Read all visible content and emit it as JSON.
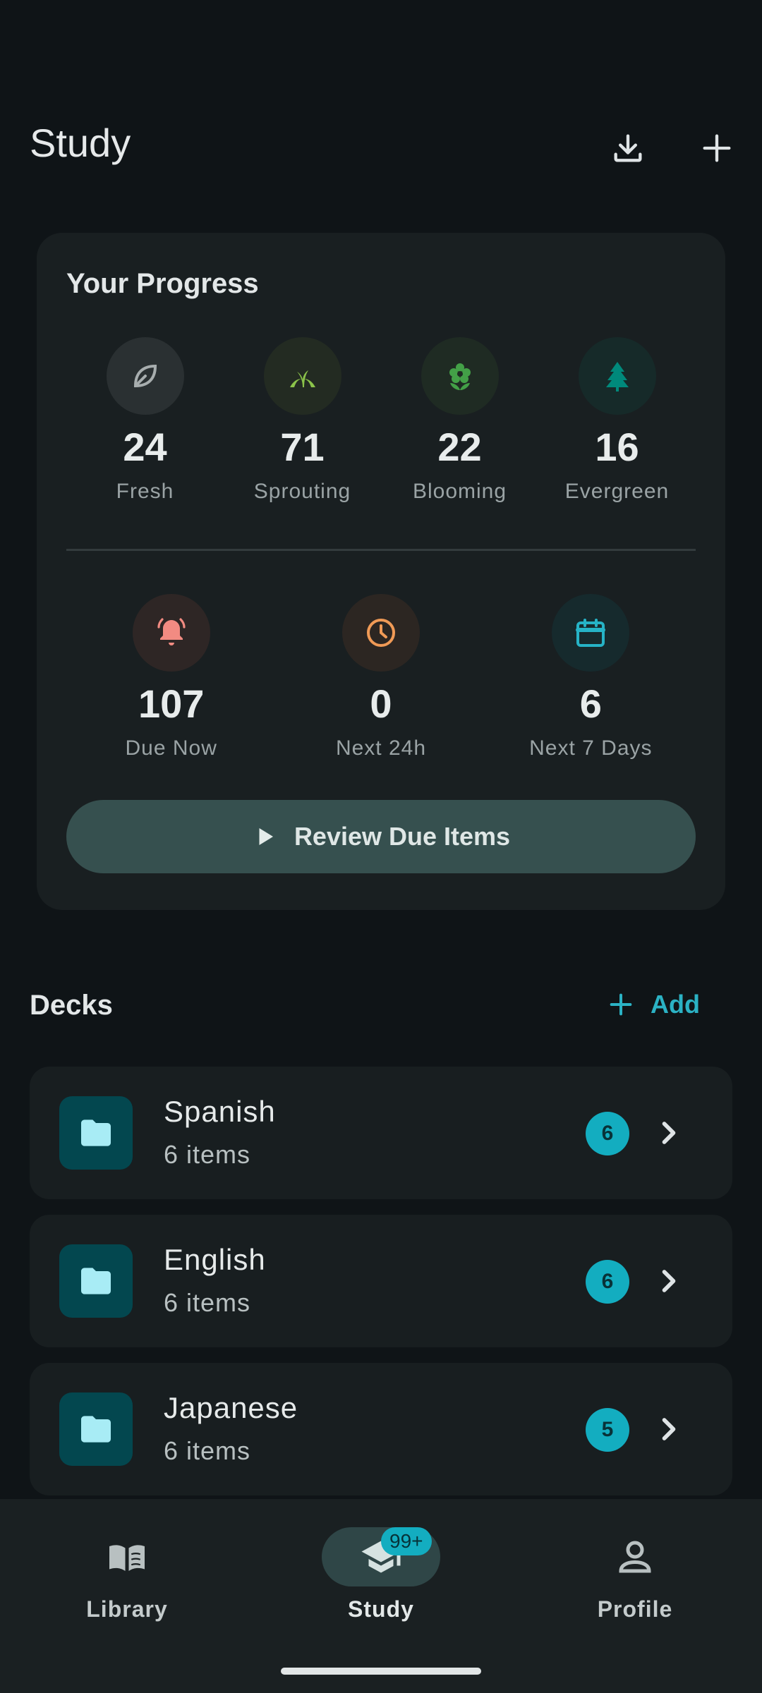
{
  "app_bar": {
    "title": "Study"
  },
  "progress": {
    "title": "Your Progress",
    "stages": [
      {
        "value": "24",
        "label": "Fresh",
        "icon": "leaf-icon",
        "color": "#a7adae"
      },
      {
        "value": "71",
        "label": "Sprouting",
        "icon": "sprout-icon",
        "color": "#8bc34a"
      },
      {
        "value": "22",
        "label": "Blooming",
        "icon": "flower-icon",
        "color": "#43a047"
      },
      {
        "value": "16",
        "label": "Evergreen",
        "icon": "tree-icon",
        "color": "#00897b"
      }
    ],
    "due": [
      {
        "value": "107",
        "label": "Due Now",
        "icon": "bell-icon",
        "color": "#f28b82"
      },
      {
        "value": "0",
        "label": "Next 24h",
        "icon": "clock-icon",
        "color": "#f09a56"
      },
      {
        "value": "6",
        "label": "Next 7 Days",
        "icon": "calendar-icon",
        "color": "#26b3c6"
      }
    ],
    "review_button": "Review Due Items"
  },
  "decks": {
    "title": "Decks",
    "add_label": "Add",
    "items": [
      {
        "name": "Spanish",
        "count": "6 items",
        "badge": "6"
      },
      {
        "name": "English",
        "count": "6 items",
        "badge": "6"
      },
      {
        "name": "Japanese",
        "count": "6 items",
        "badge": "5"
      }
    ]
  },
  "bottom_nav": {
    "items": [
      {
        "label": "Library",
        "icon": "book-icon"
      },
      {
        "label": "Study",
        "icon": "graduation-cap-icon",
        "badge": "99+",
        "selected": true
      },
      {
        "label": "Profile",
        "icon": "person-icon"
      }
    ]
  }
}
